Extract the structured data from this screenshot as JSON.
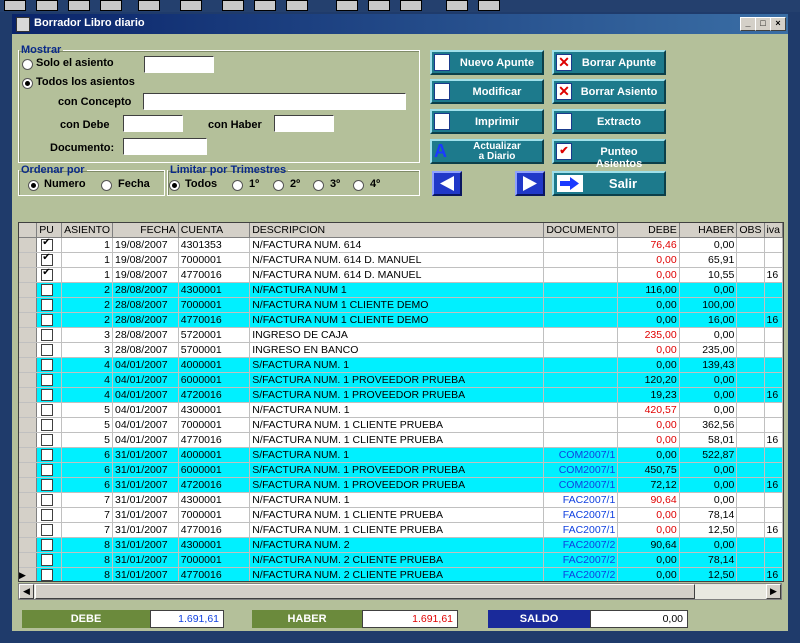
{
  "window": {
    "title": "Borrador Libro diario"
  },
  "mostrar": {
    "legend": "Mostrar",
    "solo_asiento": "Solo el asiento",
    "todos": "Todos los asientos",
    "con_concepto": "con Concepto",
    "con_debe": "con Debe",
    "con_haber": "con Haber",
    "documento": "Documento:"
  },
  "ordenar": {
    "legend": "Ordenar por",
    "numero": "Numero",
    "fecha": "Fecha"
  },
  "limitar": {
    "legend": "Limitar por Trimestres",
    "todos": "Todos",
    "t1": "1º",
    "t2": "2º",
    "t3": "3º",
    "t4": "4º"
  },
  "buttons": {
    "nuevo_apunte": "Nuevo Apunte",
    "borrar_apunte": "Borrar Apunte",
    "modificar": "Modificar",
    "borrar_asiento": "Borrar Asiento",
    "imprimir": "Imprimir",
    "extracto": "Extracto",
    "actualizar_1": "Actualizar",
    "actualizar_2": "a Diario",
    "punteo": "Punteo Asientos",
    "salir": "Salir"
  },
  "table": {
    "columns": [
      "PU",
      "ASIENTO",
      "FECHA",
      "CUENTA",
      "DESCRIPCION",
      "DOCUMENTO",
      "DEBE",
      "HABER",
      "OBS",
      "iva"
    ],
    "rows": [
      {
        "pu": true,
        "asiento": "1",
        "fecha": "19/08/2007",
        "cuenta": "4301353",
        "descripcion": "N/FACTURA NUM. 614",
        "documento": "",
        "debe": "76,46",
        "haber": "0,00",
        "obs": "",
        "iva": "",
        "cyan": false,
        "debe_red": true
      },
      {
        "pu": true,
        "asiento": "1",
        "fecha": "19/08/2007",
        "cuenta": "7000001",
        "descripcion": "N/FACTURA NUM. 614 D. MANUEL",
        "documento": "",
        "debe": "0,00",
        "haber": "65,91",
        "obs": "",
        "iva": "",
        "cyan": false,
        "debe_red": true
      },
      {
        "pu": true,
        "asiento": "1",
        "fecha": "19/08/2007",
        "cuenta": "4770016",
        "descripcion": "N/FACTURA NUM. 614 D. MANUEL",
        "documento": "",
        "debe": "0,00",
        "haber": "10,55",
        "obs": "",
        "iva": "16",
        "cyan": false,
        "debe_red": true
      },
      {
        "pu": false,
        "asiento": "2",
        "fecha": "28/08/2007",
        "cuenta": "4300001",
        "descripcion": "N/FACTURA NUM 1",
        "documento": "",
        "debe": "116,00",
        "haber": "0,00",
        "obs": "",
        "iva": "",
        "cyan": true,
        "debe_red": false
      },
      {
        "pu": false,
        "asiento": "2",
        "fecha": "28/08/2007",
        "cuenta": "7000001",
        "descripcion": "N/FACTURA NUM 1 CLIENTE DEMO",
        "documento": "",
        "debe": "0,00",
        "haber": "100,00",
        "obs": "",
        "iva": "",
        "cyan": true,
        "debe_red": false
      },
      {
        "pu": false,
        "asiento": "2",
        "fecha": "28/08/2007",
        "cuenta": "4770016",
        "descripcion": "N/FACTURA NUM 1 CLIENTE DEMO",
        "documento": "",
        "debe": "0,00",
        "haber": "16,00",
        "obs": "",
        "iva": "16",
        "cyan": true,
        "debe_red": false
      },
      {
        "pu": false,
        "asiento": "3",
        "fecha": "28/08/2007",
        "cuenta": "5720001",
        "descripcion": "INGRESO DE CAJA",
        "documento": "",
        "debe": "235,00",
        "haber": "0,00",
        "obs": "",
        "iva": "",
        "cyan": false,
        "debe_red": true
      },
      {
        "pu": false,
        "asiento": "3",
        "fecha": "28/08/2007",
        "cuenta": "5700001",
        "descripcion": "INGRESO EN BANCO",
        "documento": "",
        "debe": "0,00",
        "haber": "235,00",
        "obs": "",
        "iva": "",
        "cyan": false,
        "debe_red": true
      },
      {
        "pu": false,
        "asiento": "4",
        "fecha": "04/01/2007",
        "cuenta": "4000001",
        "descripcion": "S/FACTURA NUM. 1",
        "documento": "",
        "debe": "0,00",
        "haber": "139,43",
        "obs": "",
        "iva": "",
        "cyan": true,
        "debe_red": false
      },
      {
        "pu": false,
        "asiento": "4",
        "fecha": "04/01/2007",
        "cuenta": "6000001",
        "descripcion": "S/FACTURA NUM. 1 PROVEEDOR PRUEBA",
        "documento": "",
        "debe": "120,20",
        "haber": "0,00",
        "obs": "",
        "iva": "",
        "cyan": true,
        "debe_red": false
      },
      {
        "pu": false,
        "asiento": "4",
        "fecha": "04/01/2007",
        "cuenta": "4720016",
        "descripcion": "S/FACTURA NUM. 1 PROVEEDOR PRUEBA",
        "documento": "",
        "debe": "19,23",
        "haber": "0,00",
        "obs": "",
        "iva": "16",
        "cyan": true,
        "debe_red": false
      },
      {
        "pu": false,
        "asiento": "5",
        "fecha": "04/01/2007",
        "cuenta": "4300001",
        "descripcion": "N/FACTURA NUM. 1",
        "documento": "",
        "debe": "420,57",
        "haber": "0,00",
        "obs": "",
        "iva": "",
        "cyan": false,
        "debe_red": true
      },
      {
        "pu": false,
        "asiento": "5",
        "fecha": "04/01/2007",
        "cuenta": "7000001",
        "descripcion": "N/FACTURA NUM. 1 CLIENTE PRUEBA",
        "documento": "",
        "debe": "0,00",
        "haber": "362,56",
        "obs": "",
        "iva": "",
        "cyan": false,
        "debe_red": true
      },
      {
        "pu": false,
        "asiento": "5",
        "fecha": "04/01/2007",
        "cuenta": "4770016",
        "descripcion": "N/FACTURA NUM. 1 CLIENTE PRUEBA",
        "documento": "",
        "debe": "0,00",
        "haber": "58,01",
        "obs": "",
        "iva": "16",
        "cyan": false,
        "debe_red": true
      },
      {
        "pu": false,
        "asiento": "6",
        "fecha": "31/01/2007",
        "cuenta": "4000001",
        "descripcion": "S/FACTURA NUM. 1",
        "documento": "COM2007/1",
        "debe": "0,00",
        "haber": "522,87",
        "obs": "",
        "iva": "",
        "cyan": true,
        "debe_red": false
      },
      {
        "pu": false,
        "asiento": "6",
        "fecha": "31/01/2007",
        "cuenta": "6000001",
        "descripcion": "S/FACTURA NUM. 1 PROVEEDOR PRUEBA",
        "documento": "COM2007/1",
        "debe": "450,75",
        "haber": "0,00",
        "obs": "",
        "iva": "",
        "cyan": true,
        "debe_red": false
      },
      {
        "pu": false,
        "asiento": "6",
        "fecha": "31/01/2007",
        "cuenta": "4720016",
        "descripcion": "S/FACTURA NUM. 1 PROVEEDOR PRUEBA",
        "documento": "COM2007/1",
        "debe": "72,12",
        "haber": "0,00",
        "obs": "",
        "iva": "16",
        "cyan": true,
        "debe_red": false
      },
      {
        "pu": false,
        "asiento": "7",
        "fecha": "31/01/2007",
        "cuenta": "4300001",
        "descripcion": "N/FACTURA NUM. 1",
        "documento": "FAC2007/1",
        "debe": "90,64",
        "haber": "0,00",
        "obs": "",
        "iva": "",
        "cyan": false,
        "debe_red": true
      },
      {
        "pu": false,
        "asiento": "7",
        "fecha": "31/01/2007",
        "cuenta": "7000001",
        "descripcion": "N/FACTURA NUM. 1 CLIENTE PRUEBA",
        "documento": "FAC2007/1",
        "debe": "0,00",
        "haber": "78,14",
        "obs": "",
        "iva": "",
        "cyan": false,
        "debe_red": true
      },
      {
        "pu": false,
        "asiento": "7",
        "fecha": "31/01/2007",
        "cuenta": "4770016",
        "descripcion": "N/FACTURA NUM. 1 CLIENTE PRUEBA",
        "documento": "FAC2007/1",
        "debe": "0,00",
        "haber": "12,50",
        "obs": "",
        "iva": "16",
        "cyan": false,
        "debe_red": true
      },
      {
        "pu": false,
        "asiento": "8",
        "fecha": "31/01/2007",
        "cuenta": "4300001",
        "descripcion": "N/FACTURA NUM. 2",
        "documento": "FAC2007/2",
        "debe": "90,64",
        "haber": "0,00",
        "obs": "",
        "iva": "",
        "cyan": true,
        "debe_red": false
      },
      {
        "pu": false,
        "asiento": "8",
        "fecha": "31/01/2007",
        "cuenta": "7000001",
        "descripcion": "N/FACTURA NUM. 2 CLIENTE PRUEBA",
        "documento": "FAC2007/2",
        "debe": "0,00",
        "haber": "78,14",
        "obs": "",
        "iva": "",
        "cyan": true,
        "debe_red": false
      },
      {
        "pu": false,
        "asiento": "8",
        "fecha": "31/01/2007",
        "cuenta": "4770016",
        "descripcion": "N/FACTURA NUM. 2 CLIENTE PRUEBA",
        "documento": "FAC2007/2",
        "debe": "0,00",
        "haber": "12,50",
        "obs": "",
        "iva": "16",
        "cyan": true,
        "debe_red": false
      }
    ]
  },
  "totals": {
    "debe_label": "DEBE",
    "debe_value": "1.691,61",
    "haber_label": "HABER",
    "haber_value": "1.691,61",
    "saldo_label": "SALDO",
    "saldo_value": "0,00"
  }
}
